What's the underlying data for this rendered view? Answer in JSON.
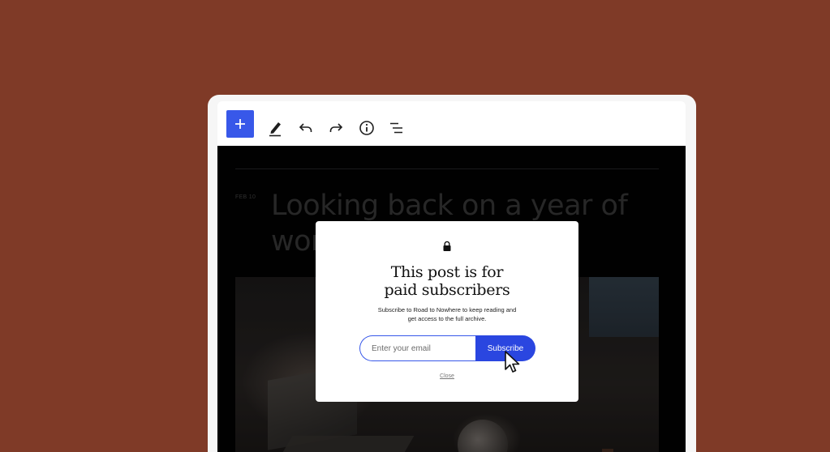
{
  "toolbar": {
    "add_icon": "plus-icon",
    "tools": [
      "pencil-icon",
      "undo-icon",
      "redo-icon",
      "info-icon",
      "list-view-icon"
    ],
    "accent": "#3858e9"
  },
  "post": {
    "date": "FEB 10",
    "title": "Looking back on a year of wor"
  },
  "modal": {
    "icon": "lock-icon",
    "title_line1": "This post is for",
    "title_line2": "paid subscribers",
    "desc_line1": "Subscribe to Road to Nowhere to keep reading and",
    "desc_line2": "get access to the full archive.",
    "email_placeholder": "Enter your email",
    "subscribe_label": "Subscribe",
    "close_label": "Close"
  },
  "colors": {
    "background": "#7f3a27",
    "subscribe_button": "#2a46e0"
  }
}
